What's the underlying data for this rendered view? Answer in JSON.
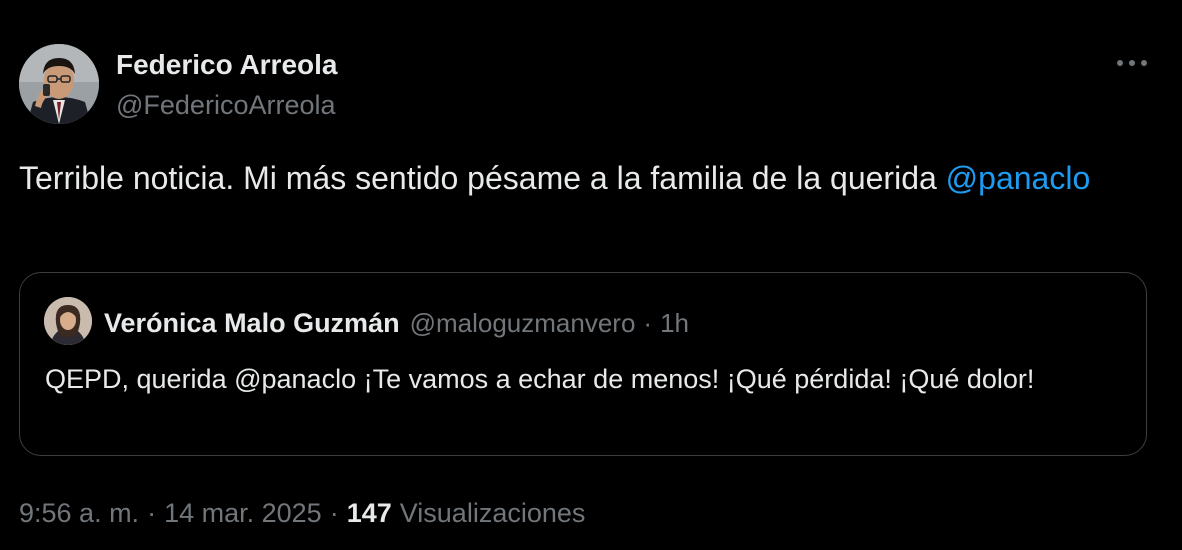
{
  "author": {
    "name": "Federico Arreola",
    "handle": "@FedericoArreola"
  },
  "tweet": {
    "text": "Terrible noticia. Mi más sentido pésame a la familia de la querida ",
    "mention": "@panaclo"
  },
  "quoted": {
    "name": "Verónica Malo Guzmán",
    "handle": "@maloguzmanvero",
    "separator": "·",
    "time": "1h",
    "text": "QEPD, querida @panaclo ¡Te vamos a echar de menos! ¡Qué pérdida! ¡Qué dolor!"
  },
  "meta": {
    "time": "9:56 a. m.",
    "separator": "·",
    "date": "14 mar. 2025",
    "views_count": "147",
    "views_label": "Visualizaciones"
  },
  "icons": {
    "more": "more-horizontal-icon"
  },
  "colors": {
    "background": "#000000",
    "text": "#e7e9ea",
    "secondary": "#71767b",
    "link": "#1d9bf0",
    "border": "#3a3e42"
  }
}
